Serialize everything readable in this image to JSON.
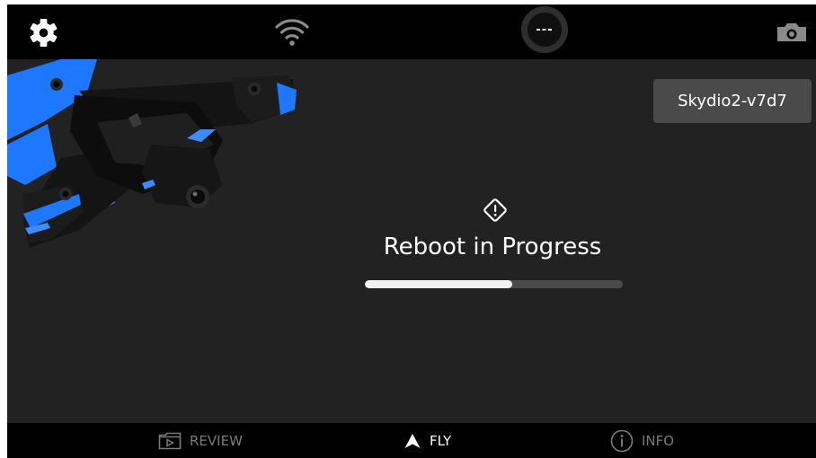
{
  "topbar": {
    "icons": [
      "gear-icon",
      "wifi-icon",
      "camera-icon"
    ],
    "status_text": "---"
  },
  "device": {
    "name": "Skydio2-v7d7"
  },
  "status": {
    "icon": "warning-diamond-icon",
    "title": "Reboot in Progress",
    "progress": 0.57
  },
  "nav": {
    "tabs": [
      {
        "label": "REVIEW",
        "icon": "play-folder-icon",
        "active": false
      },
      {
        "label": "FLY",
        "icon": "arrow-up-icon",
        "active": true
      },
      {
        "label": "INFO",
        "icon": "info-icon",
        "active": false
      }
    ]
  },
  "colors": {
    "accent": "#1e78ff",
    "background": "#232223",
    "bar": "#000000"
  }
}
